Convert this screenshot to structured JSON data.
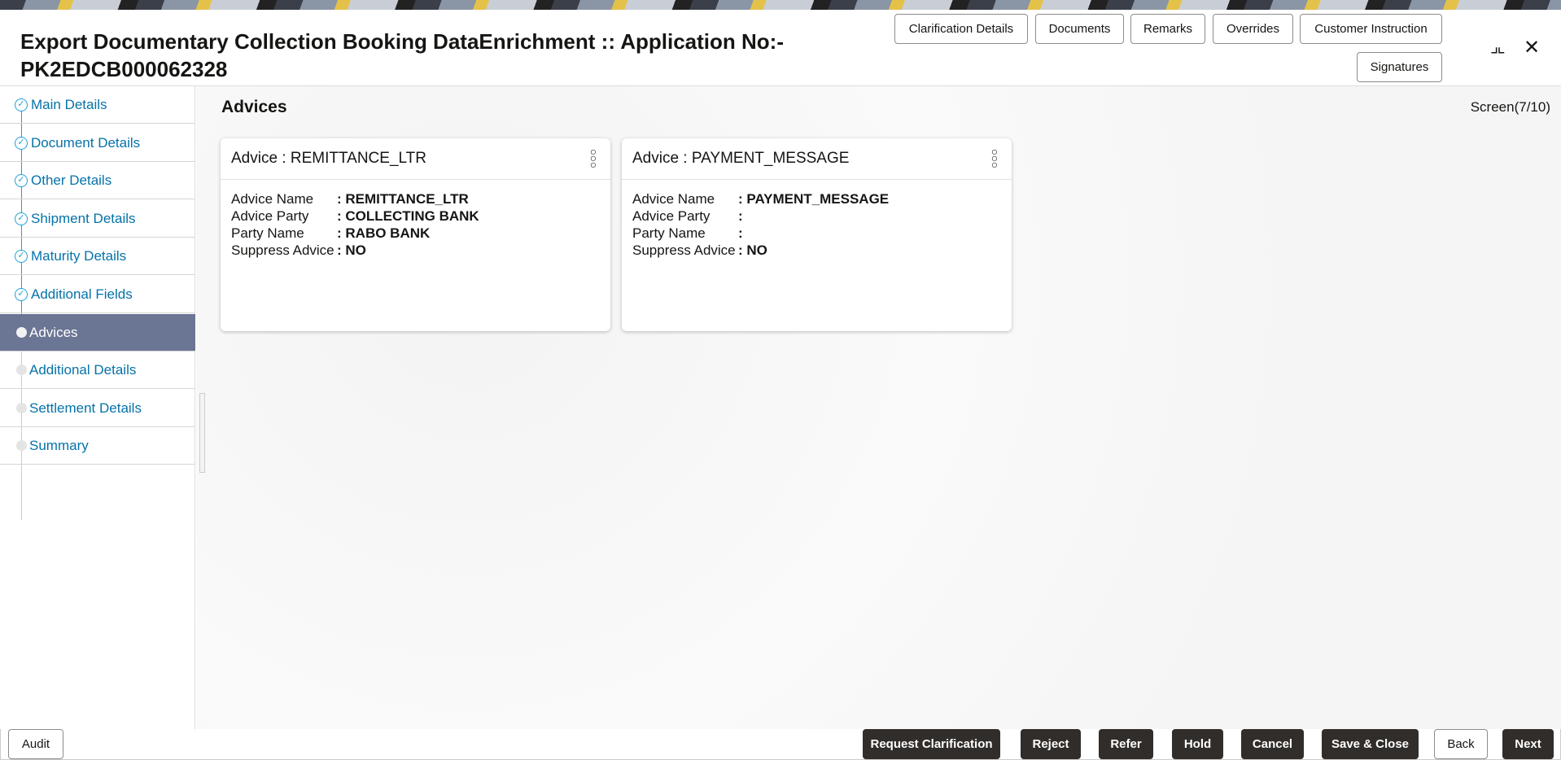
{
  "header": {
    "title": "Export Documentary Collection Booking DataEnrichment :: Application No:- PK2EDCB000062328",
    "buttons": [
      "Clarification Details",
      "Documents",
      "Remarks",
      "Overrides",
      "Customer Instruction",
      "Signatures"
    ]
  },
  "sidebar": {
    "items": [
      {
        "label": "Main Details",
        "state": "done"
      },
      {
        "label": "Document Details",
        "state": "done"
      },
      {
        "label": "Other Details",
        "state": "done"
      },
      {
        "label": "Shipment Details",
        "state": "done"
      },
      {
        "label": "Maturity Details",
        "state": "done"
      },
      {
        "label": "Additional Fields",
        "state": "done"
      },
      {
        "label": "Advices",
        "state": "current"
      },
      {
        "label": "Additional Details",
        "state": "todo"
      },
      {
        "label": "Settlement Details",
        "state": "todo"
      },
      {
        "label": "Summary",
        "state": "todo"
      }
    ]
  },
  "content": {
    "title": "Advices",
    "screen": "Screen(7/10)",
    "cards": [
      {
        "title": "Advice : REMITTANCE_LTR",
        "rows": [
          {
            "k": "Advice Name",
            "v": ": REMITTANCE_LTR"
          },
          {
            "k": "Advice Party",
            "v": ": COLLECTING BANK"
          },
          {
            "k": "Party Name",
            "v": ": RABO BANK"
          },
          {
            "k": "Suppress Advice",
            "v": ": NO"
          }
        ]
      },
      {
        "title": "Advice : PAYMENT_MESSAGE",
        "rows": [
          {
            "k": "Advice Name",
            "v": ": PAYMENT_MESSAGE"
          },
          {
            "k": "Advice Party",
            "v": ":"
          },
          {
            "k": "Party Name",
            "v": ":"
          },
          {
            "k": "Suppress Advice",
            "v": ": NO"
          }
        ]
      }
    ]
  },
  "footer": {
    "audit": "Audit",
    "buttons": [
      "Request Clarification",
      "Reject",
      "Refer",
      "Hold",
      "Cancel",
      "Save & Close",
      "Back",
      "Next"
    ]
  }
}
